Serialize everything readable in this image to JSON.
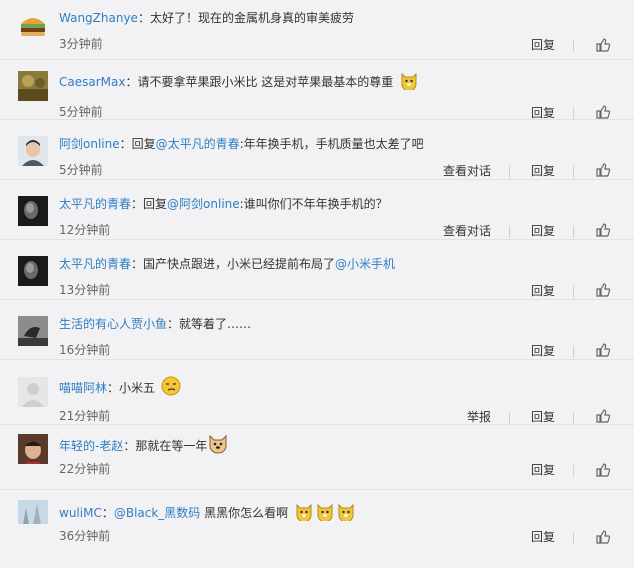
{
  "actions": {
    "reply": "回复",
    "view_dialog": "查看对话",
    "report": "举报"
  },
  "comments": [
    {
      "user": "WangZhanye",
      "text": "：太好了！现在的金属机身真的审美疲劳",
      "time": "3分钟前"
    },
    {
      "user": "CaesarMax",
      "text": "：请不要拿苹果跟小米比 这是对苹果最基本的尊重",
      "time": "5分钟前"
    },
    {
      "user": "阿剑online",
      "pre": "：回复",
      "mention": "@太平凡的青春",
      "text": ":年年换手机，手机质量也太差了吧",
      "time": "5分钟前"
    },
    {
      "user": "太平凡的青春",
      "pre": "：回复",
      "mention": "@阿剑online",
      "text": ":谁叫你们不年年换手机的？",
      "time": "12分钟前"
    },
    {
      "user": "太平凡的青春",
      "text": "：国产快点跟进，小米已经提前布局了",
      "mention": "@小米手机",
      "time": "13分钟前"
    },
    {
      "user": "生活的有心人贾小鱼",
      "text": "：就等着了……",
      "time": "16分钟前"
    },
    {
      "user": "喵喵阿林",
      "text": "：小米五",
      "time": "21分钟前"
    },
    {
      "user": "年轻的-老赵",
      "text": "：那就在等一年",
      "time": "22分钟前"
    },
    {
      "user": "wuliMC",
      "pre": "：",
      "mention": "@Black_黑数码",
      "text": " 黑黑你怎么看啊",
      "time": "36分钟前"
    }
  ],
  "icons": {
    "like": "thumbs-up-icon",
    "doge": "doge-emoji-icon",
    "smirk": "smirk-emoji-icon",
    "dog": "dog-emoji-icon"
  },
  "colors": {
    "link": "#2f7ec2",
    "background": "#f2f2f5",
    "divider": "#e2e2e6"
  }
}
